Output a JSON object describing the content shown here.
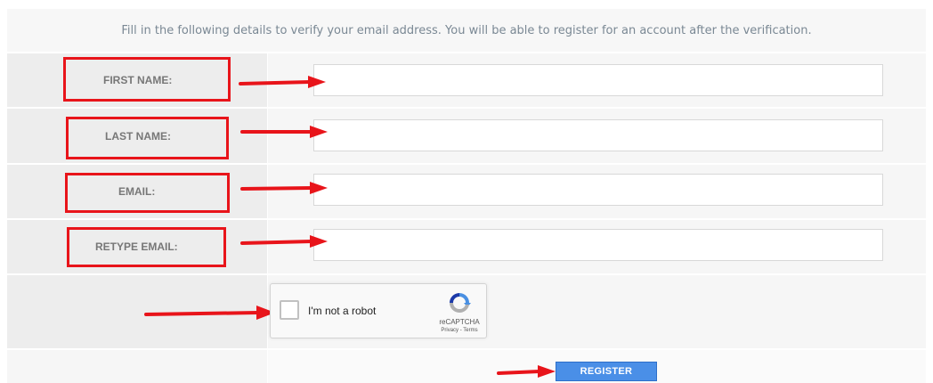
{
  "intro_text": "Fill in the following details to verify your email address. You will be able to register for an account after the verification.",
  "fields": {
    "first_name": {
      "label": "FIRST NAME:",
      "value": ""
    },
    "last_name": {
      "label": "LAST NAME:",
      "value": ""
    },
    "email": {
      "label": "EMAIL:",
      "value": ""
    },
    "retype_email": {
      "label": "RETYPE EMAIL:",
      "value": ""
    }
  },
  "recaptcha": {
    "label": "I'm not a robot",
    "brand": "reCAPTCHA",
    "terms": "Privacy - Terms"
  },
  "register_label": "REGISTER",
  "colors": {
    "annotation_red": "#e8141a",
    "button_blue": "#4a8fe7"
  }
}
